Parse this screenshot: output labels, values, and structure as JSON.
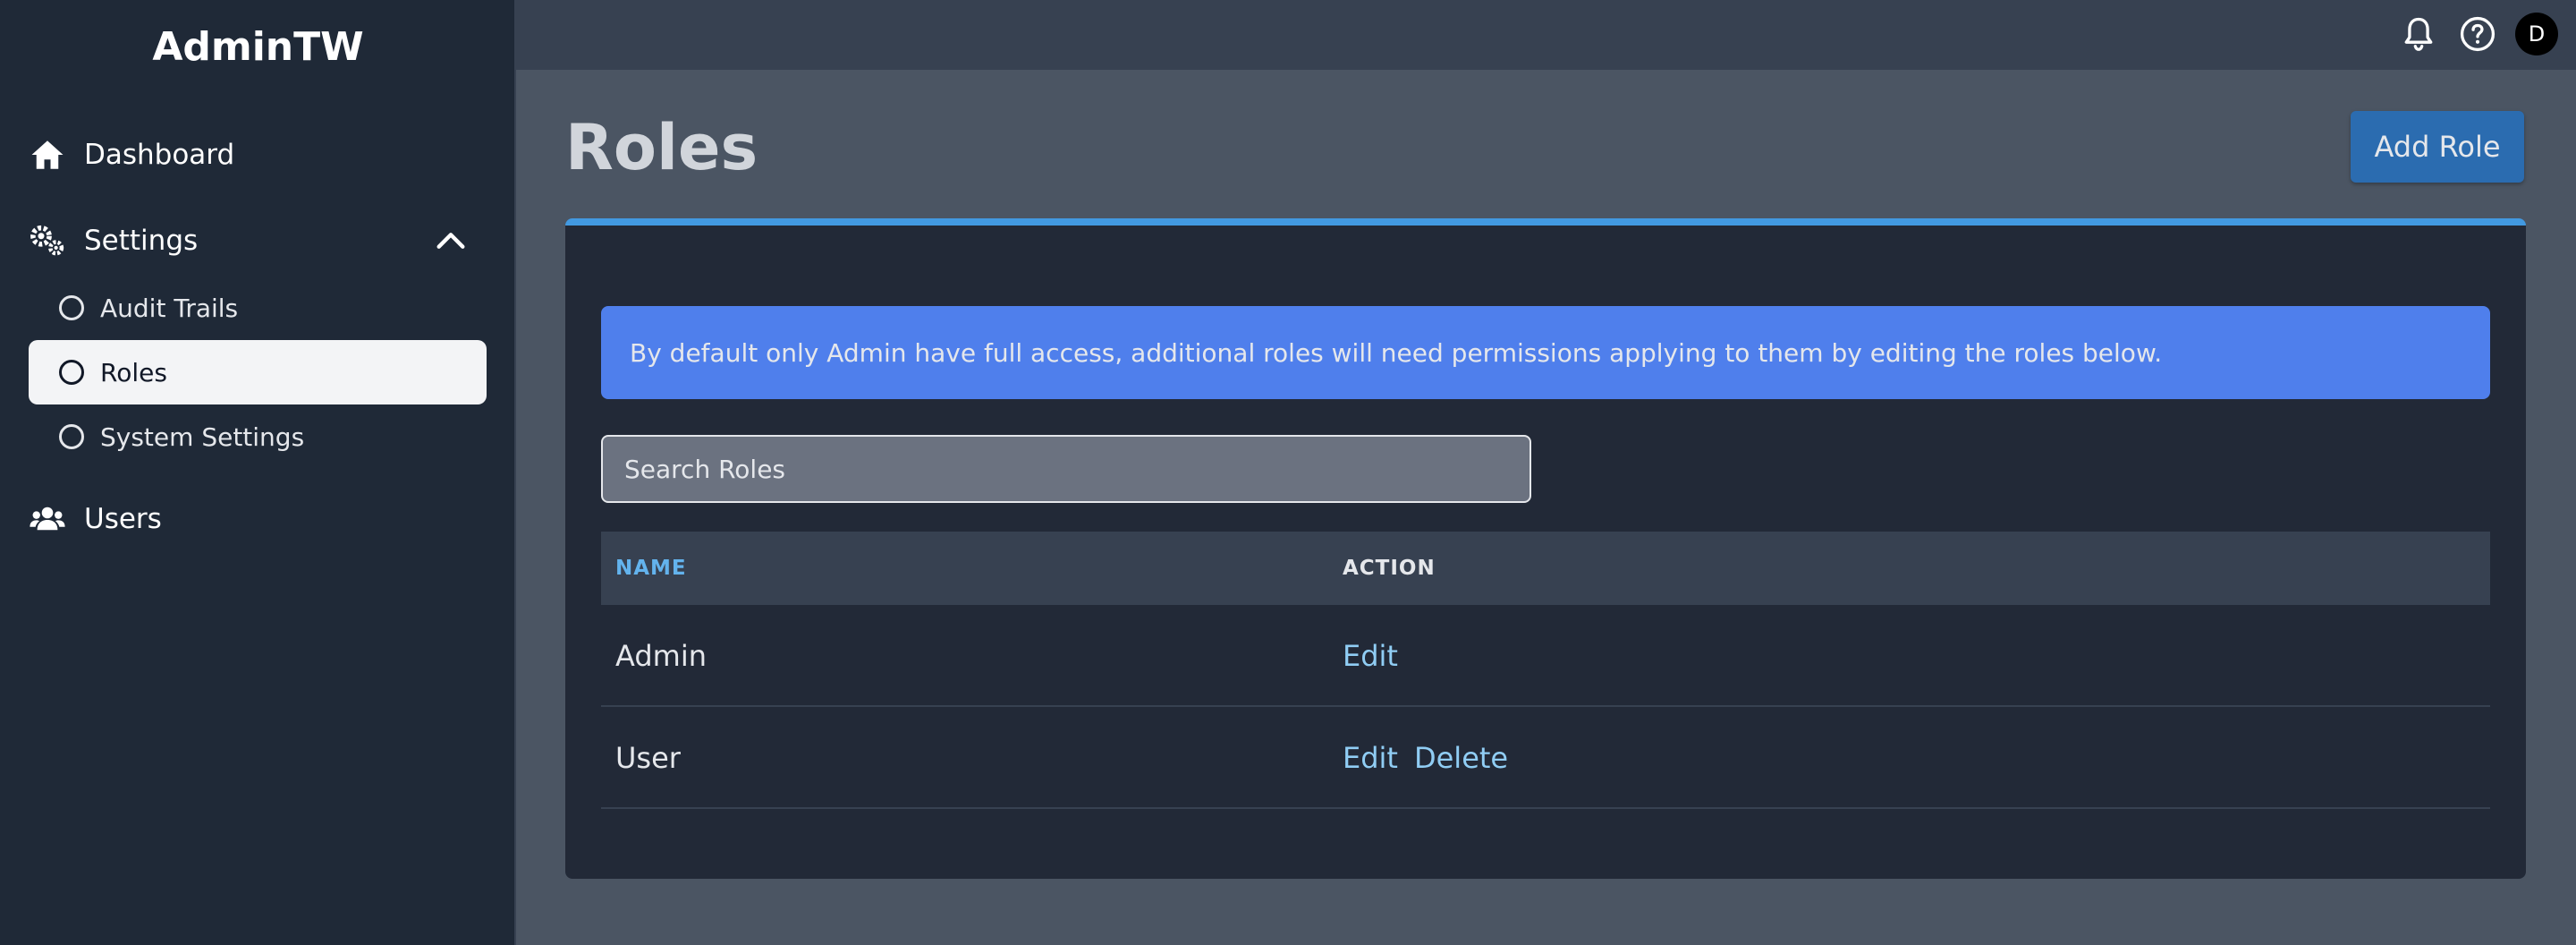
{
  "app": {
    "brand": "AdminTW"
  },
  "sidebar": {
    "dashboard": {
      "label": "Dashboard",
      "icon": "home-icon"
    },
    "settings": {
      "label": "Settings",
      "icon": "cogs-icon",
      "expanded": true,
      "children": [
        {
          "label": "Audit Trails",
          "active": false
        },
        {
          "label": "Roles",
          "active": true
        },
        {
          "label": "System Settings",
          "active": false
        }
      ]
    },
    "users": {
      "label": "Users",
      "icon": "users-icon"
    }
  },
  "topbar": {
    "avatar_initial": "D",
    "icons": [
      "bell-icon",
      "help-icon"
    ]
  },
  "main": {
    "title": "Roles",
    "add_button": "Add Role",
    "alert": "By default only Admin have full access, additional roles will need permissions applying to them by editing the roles below.",
    "search_placeholder": "Search Roles",
    "table": {
      "columns": [
        "NAME",
        "ACTION"
      ],
      "rows": [
        {
          "name": "Admin",
          "actions": [
            "Edit"
          ]
        },
        {
          "name": "User",
          "actions": [
            "Edit",
            "Delete"
          ]
        }
      ]
    }
  },
  "colors": {
    "sidebar_bg": "#1f2937",
    "topbar_bg": "#374151",
    "page_bg": "#4b5563",
    "card_bg": "#222937",
    "card_accent": "#4299e1",
    "alert_bg": "#4f7fec",
    "button_bg": "#2b6cb0",
    "link": "#90cdf4"
  }
}
